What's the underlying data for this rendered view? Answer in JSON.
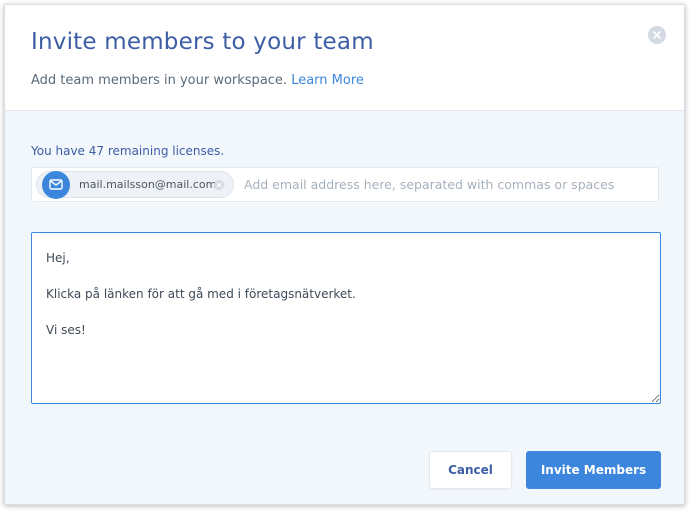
{
  "dialog": {
    "title": "Invite members to your team",
    "subtitle": "Add team members in your workspace. ",
    "learn_more": "Learn More"
  },
  "licenses": {
    "text": "You have 47 remaining licenses."
  },
  "email_field": {
    "chips": [
      {
        "email": "mail.mailsson@mail.com",
        "icon": "envelope-icon"
      }
    ],
    "value": "",
    "placeholder": "Add email address here, separated with commas or spaces"
  },
  "message": {
    "lines": [
      "Hej,",
      "Klicka på länken för att gå med i företagsnätverket.",
      "Vi ses!"
    ]
  },
  "buttons": {
    "cancel": "Cancel",
    "invite": "Invite Members"
  },
  "colors": {
    "accent": "#3d86dd",
    "title": "#3d5da5",
    "background": "#f2f7fc"
  }
}
